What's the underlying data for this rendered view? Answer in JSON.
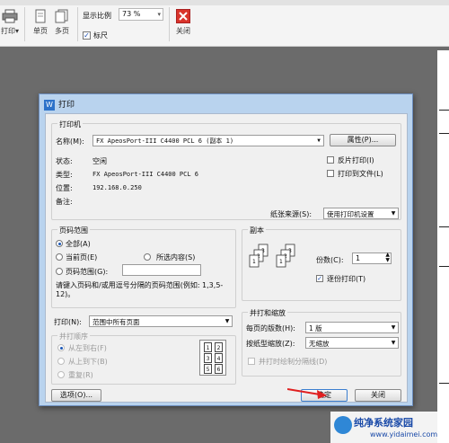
{
  "toolbar": {
    "print_label": "打印",
    "single_page": "单页",
    "multi_page": "多页",
    "zoom_label": "显示比例",
    "zoom_value": "73 %",
    "ruler_label": "标尺",
    "close_label": "关闭"
  },
  "dialog": {
    "title": "打印",
    "printer": {
      "legend": "打印机",
      "name_label": "名称(M):",
      "name_value": "FX ApeosPort-III C4400 PCL 6 (副本 1)",
      "properties_button": "属性(P)...",
      "status_label": "状态:",
      "status_value": "空闲",
      "type_label": "类型:",
      "type_value": "FX ApeosPort-III C4400 PCL 6",
      "location_label": "位置:",
      "location_value": "192.168.0.250",
      "comment_label": "备注:",
      "reverse_print": "反片打印(I)",
      "print_to_file": "打印到文件(L)",
      "paper_source_label": "纸张来源(S):",
      "paper_source_value": "使用打印机设置"
    },
    "page_range": {
      "legend": "页码范围",
      "all": "全部(A)",
      "current": "当前页(E)",
      "selection": "所选内容(S)",
      "pages": "页码范围(G):",
      "hint": "请键入页码和/或用逗号分隔的页码范围(例如: 1,3,5-12)。"
    },
    "print_what": {
      "label": "打印(N):",
      "value": "范围中所有页面"
    },
    "order": {
      "legend": "并打顺序",
      "left_to_right": "从左到右(F)",
      "top_to_bottom": "从上到下(B)",
      "repeat": "重复(R)",
      "grid": [
        "1",
        "2",
        "3",
        "4",
        "5",
        "6"
      ]
    },
    "copies": {
      "legend": "副本",
      "count_label": "份数(C):",
      "count_value": "1",
      "collate": "逐份打印(T)"
    },
    "zoom": {
      "legend": "并打和缩放",
      "pages_per_sheet_label": "每页的版数(H):",
      "pages_per_sheet_value": "1 版",
      "scale_label": "按纸型缩放(Z):",
      "scale_value": "无缩放",
      "draw_border": "并打时绘制分隔线(D)"
    },
    "options_button": "选项(O)...",
    "ok_button": "确定",
    "close_button": "关闭"
  },
  "watermark": {
    "title": "纯净系统家园",
    "url": "www.yidaimei.com"
  }
}
